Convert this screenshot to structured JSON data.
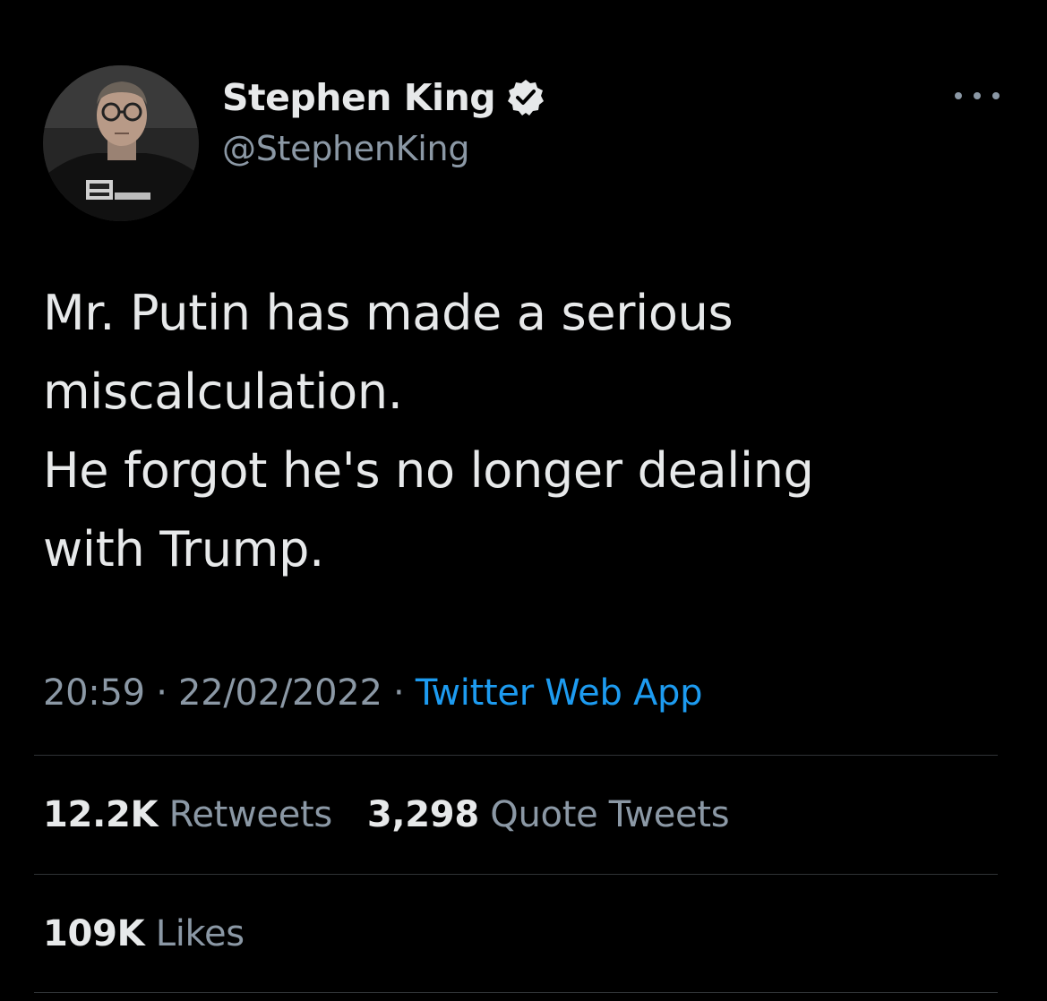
{
  "author": {
    "display_name": "Stephen King",
    "handle": "@StephenKing",
    "verified": true,
    "avatar_icon": "avatar-photo"
  },
  "header": {
    "more_icon": "more-horizontal-icon"
  },
  "tweet": {
    "lines": [
      "Mr. Putin has made a serious",
      "miscalculation.",
      "He forgot he's no longer dealing",
      "with Trump."
    ]
  },
  "meta": {
    "time": "20:59",
    "separator": "·",
    "date": "22/02/2022",
    "source": "Twitter Web App"
  },
  "stats": {
    "retweets_count": "12.2K",
    "retweets_label": "Retweets",
    "quotes_count": "3,298",
    "quotes_label": "Quote Tweets",
    "likes_count": "109K",
    "likes_label": "Likes"
  },
  "colors": {
    "background": "#000000",
    "text_primary": "#e7e9ea",
    "text_secondary": "#8b98a5",
    "link": "#1d9bf0",
    "divider": "#2f3336"
  }
}
